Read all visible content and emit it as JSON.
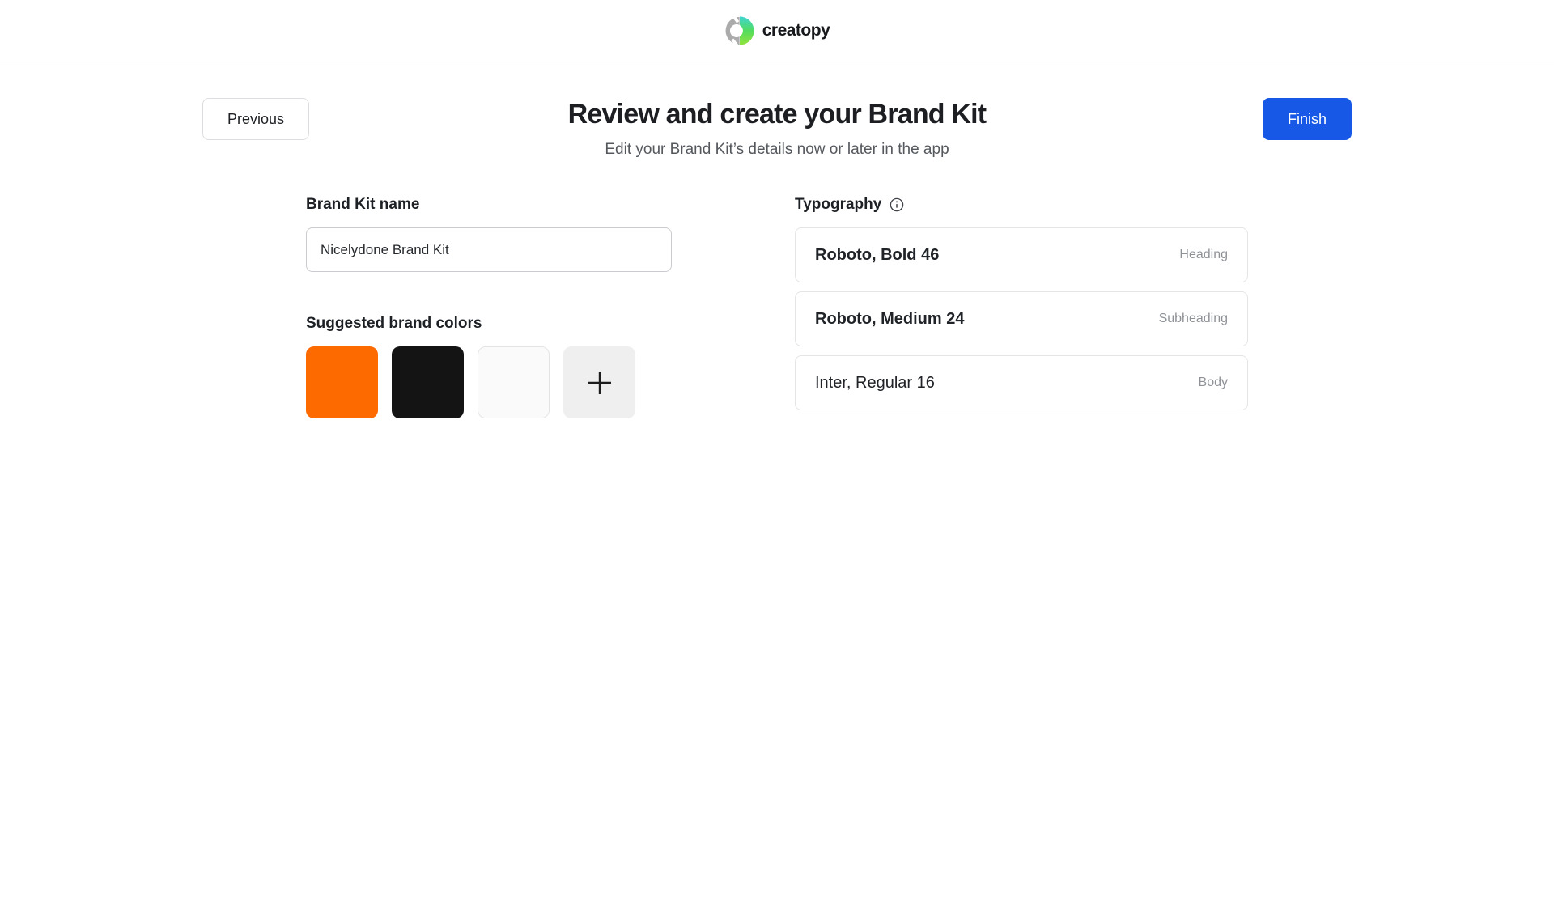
{
  "header": {
    "logo_text": "creatopy"
  },
  "toolbar": {
    "previous_label": "Previous",
    "title": "Review and create your Brand Kit",
    "subtitle": "Edit your Brand Kit’s details now or later in the app",
    "finish_label": "Finish"
  },
  "brand_kit": {
    "name_label": "Brand Kit name",
    "name_value": "Nicelydone Brand Kit",
    "colors_label": "Suggested brand colors",
    "swatches": [
      {
        "name": "orange",
        "hex": "#FC6A00"
      },
      {
        "name": "black",
        "hex": "#141415"
      },
      {
        "name": "white",
        "hex": "#FAFAFA"
      }
    ]
  },
  "typography": {
    "label": "Typography",
    "items": [
      {
        "font": "Roboto, Bold 46",
        "role": "Heading",
        "weight": "bold"
      },
      {
        "font": "Roboto, Medium 24",
        "role": "Subheading",
        "weight": "medium"
      },
      {
        "font": "Inter, Regular 16",
        "role": "Body",
        "weight": "regular"
      }
    ]
  },
  "colors": {
    "accent_blue": "#1759E6",
    "logo_gray": "#ABABAB",
    "logo_teal": "#3FD4D4",
    "logo_green": "#92E33C",
    "header_border": "#ECECEE"
  }
}
